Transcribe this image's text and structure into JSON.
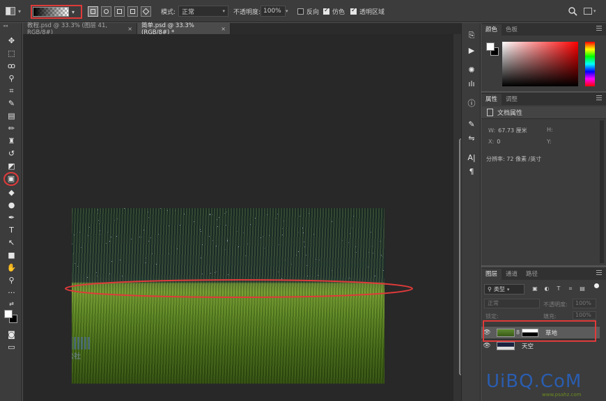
{
  "options_bar": {
    "mode_label": "模式:",
    "mode_value": "正常",
    "opacity_label": "不透明度:",
    "opacity_value": "100%",
    "reverse_label": "反向",
    "reverse_checked": false,
    "dither_label": "仿色",
    "dither_checked": true,
    "transparency_label": "透明区域",
    "transparency_checked": true
  },
  "tabs": [
    {
      "label": "教程.psd @ 33.3% (图层 41, RGB/8#)",
      "active": false
    },
    {
      "label": "简单.psd @ 33.3%(RGB/8#) *",
      "active": true
    }
  ],
  "color_panel": {
    "tabs": [
      "颜色",
      "色板"
    ],
    "foreground": "#ffffff",
    "background": "#000000"
  },
  "properties_panel": {
    "tabs": [
      "属性",
      "调整"
    ],
    "header": "文档属性",
    "w_label": "W:",
    "w_value": "67.73 厘米",
    "h_label": "H:",
    "x_label": "X:",
    "x_value": "0",
    "y_label": "Y:",
    "resolution": "分辨率: 72 像素 /英寸"
  },
  "layers_panel": {
    "tabs": [
      "图层",
      "通道",
      "路径"
    ],
    "filter_label": "类型",
    "blend_mode": "正常",
    "opacity_label": "不透明度:",
    "opacity_value": "100%",
    "lock_label": "锁定:",
    "fill_label": "填充:",
    "fill_value": "100%",
    "layers": [
      {
        "name": "草地",
        "selected": true
      },
      {
        "name": "天空",
        "selected": false
      }
    ]
  },
  "watermark": {
    "brand": "UiBQ.CoM",
    "url": "www.psahz.com",
    "canvas_logo_text": "素材公社"
  },
  "accent_colors": {
    "highlight": "#e03a3a",
    "brand": "#2a5db0"
  }
}
